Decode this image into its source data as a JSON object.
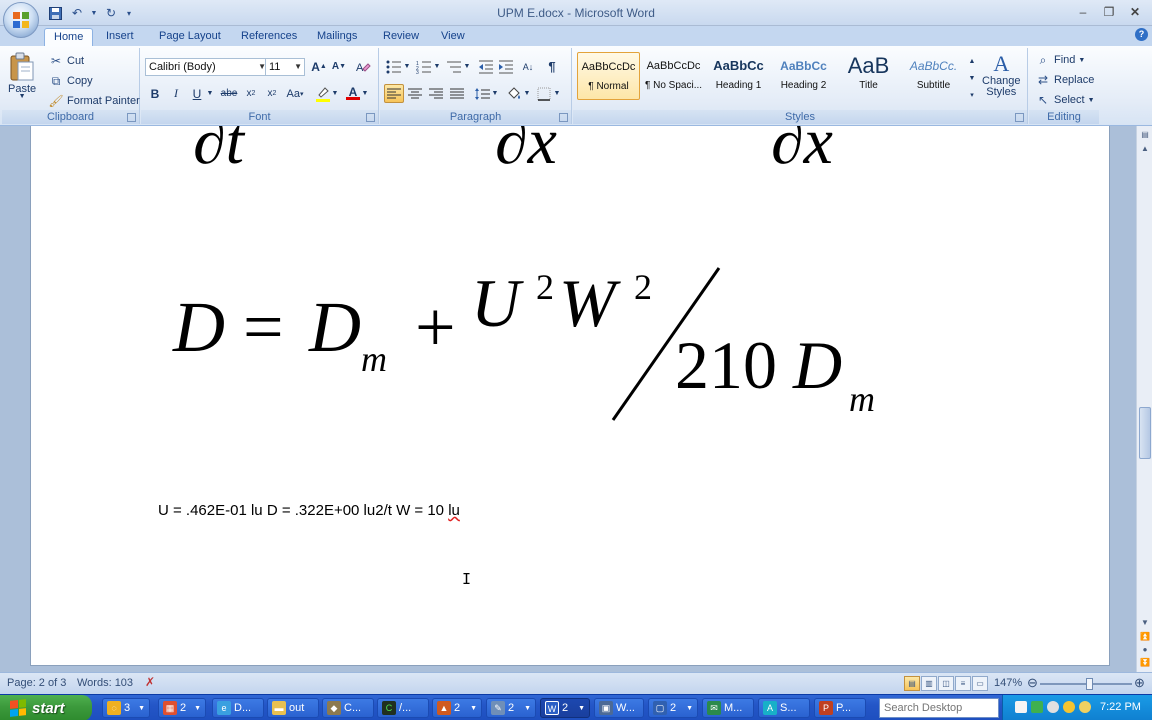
{
  "app": {
    "title": "UPM E.docx - Microsoft Word",
    "colors": {
      "ribbon_bg": "#e4ecf7",
      "tab_bg": "#c4d7f0",
      "taskbar": "#2456c7",
      "start_green": "#3c9a3c",
      "accent": "#15428b"
    }
  },
  "tabs": [
    {
      "label": "Home",
      "active": true
    },
    {
      "label": "Insert"
    },
    {
      "label": "Page Layout"
    },
    {
      "label": "References"
    },
    {
      "label": "Mailings"
    },
    {
      "label": "Review"
    },
    {
      "label": "View"
    }
  ],
  "ribbon": {
    "clipboard": {
      "label": "Clipboard",
      "paste": "Paste",
      "cut": "Cut",
      "copy": "Copy",
      "format_painter": "Format Painter"
    },
    "font": {
      "label": "Font",
      "font_name": "Calibri (Body)",
      "font_size": "11"
    },
    "paragraph": {
      "label": "Paragraph"
    },
    "styles": {
      "label": "Styles",
      "items": [
        {
          "sample": "AaBbCcDc",
          "name": "¶ Normal"
        },
        {
          "sample": "AaBbCcDc",
          "name": "¶ No Spaci..."
        },
        {
          "sample": "AaBbCc",
          "name": "Heading 1"
        },
        {
          "sample": "AaBbCc",
          "name": "Heading 2"
        },
        {
          "sample": "AaB",
          "name": "Title"
        },
        {
          "sample": "AaBbCc.",
          "name": "Subtitle"
        }
      ],
      "change_styles_1": "Change",
      "change_styles_2": "Styles"
    },
    "editing": {
      "label": "Editing",
      "find": "Find",
      "replace": "Replace",
      "select": "Select"
    }
  },
  "document": {
    "partial_top": [
      "∂t",
      "∂x",
      "∂x"
    ],
    "equation": {
      "lhs": "D",
      "eq": "=",
      "d": "D",
      "sub_m": "m",
      "plus": "+",
      "u": "U",
      "sq1": "2",
      "w": "W",
      "sq2": "2",
      "den_num": "210",
      "den_d": "D",
      "den_sub": "m"
    },
    "values_line": "U = .462E-01 lu D = .322E+00 lu2/t W = 10 ",
    "values_line_end": "lu"
  },
  "statusbar": {
    "page": "Page: 2 of 3",
    "words": "Words: 103",
    "zoom": "147%"
  },
  "taskbar": {
    "start": "start",
    "tasks": [
      {
        "label": "3",
        "icon": "chat-icon"
      },
      {
        "label": "2",
        "icon": "calendar-icon"
      },
      {
        "label": "D...",
        "icon": "browser-icon"
      },
      {
        "label": "out",
        "icon": "folder-icon"
      },
      {
        "label": "C...",
        "icon": "app-icon"
      },
      {
        "label": "/...",
        "icon": "terminal-icon"
      },
      {
        "label": "2",
        "icon": "matlab-icon"
      },
      {
        "label": "2",
        "icon": "notepad-icon"
      },
      {
        "label": "2",
        "icon": "word-icon"
      },
      {
        "label": "W...",
        "icon": "computer-icon"
      },
      {
        "label": "2",
        "icon": "window-icon"
      },
      {
        "label": "M...",
        "icon": "mail-icon"
      },
      {
        "label": "S...",
        "icon": "acrobat-icon"
      },
      {
        "label": "P...",
        "icon": "powerpoint-icon"
      }
    ],
    "search_placeholder": "Search Desktop",
    "clock": "7:22 PM"
  }
}
